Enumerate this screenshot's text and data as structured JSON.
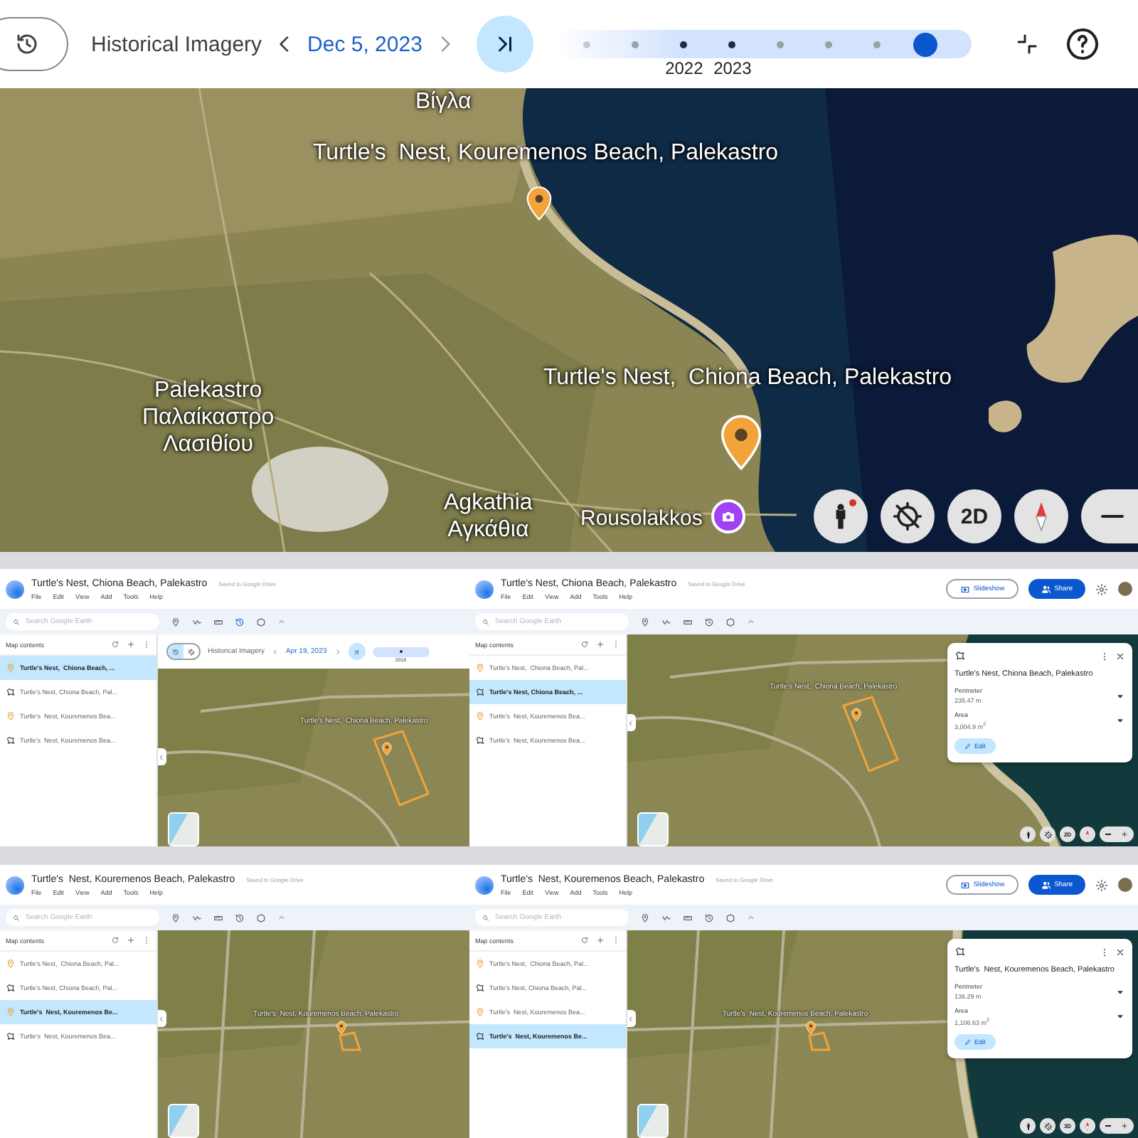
{
  "top_bar": {
    "history_label": "Historical Imagery",
    "date": "Dec 5, 2023",
    "timeline": [
      {
        "selected": false
      },
      {
        "selected": false
      },
      {
        "label": "2022",
        "selected": false
      },
      {
        "label": "2023",
        "selected": false
      },
      {
        "selected": false
      },
      {
        "selected": false
      },
      {
        "selected": false
      },
      {
        "selected": true
      }
    ]
  },
  "map": {
    "labels": [
      {
        "text": "Βίγλα"
      },
      {
        "text": "Turtle's  Nest, Kouremenos Beach, Palekastro"
      },
      {
        "text": "Turtle's Nest,  Chiona Beach, Palekastro"
      },
      {
        "text": "Palekastro\nΠαλαίκαστρο\nΛασιθίου"
      },
      {
        "text": "Agkathia\nΑγκάθια"
      },
      {
        "text": "Rousolakkos"
      }
    ],
    "mode_button": "2D"
  },
  "panels": [
    {
      "kind": "chiona",
      "title": "Turtle's Nest, Chiona Beach, Palekastro",
      "saved": "Saved to Google Drive",
      "menu": [
        "File",
        "Edit",
        "View",
        "Add",
        "Tools",
        "Help"
      ],
      "search": {
        "placeholder": "Search Google Earth"
      },
      "sidebar_title": "Map contents",
      "items": [
        {
          "kind": "pin",
          "label": "Turtle's Nest,  Chiona Beach, ...",
          "selected": true
        },
        {
          "kind": "polygon",
          "label": "Turtle's Nest, Chiona Beach, Pal...",
          "selected": false
        },
        {
          "kind": "pin",
          "label": "Turtle's  Nest, Kouremenos Bea...",
          "selected": false
        },
        {
          "kind": "polygon",
          "label": "Turtle's  Nest, Kouremenos Bea...",
          "selected": false
        }
      ],
      "history": {
        "label": "Historical Imagery",
        "date": "Apr 19, 2023",
        "year": "2018",
        "modes": [
          {
            "selected": true
          },
          {
            "selected": false
          }
        ]
      },
      "map_label": "Turtle's Nest,  Chiona Beach, Palekastro"
    },
    {
      "kind": "chiona",
      "title": "Turtle's Nest, Chiona Beach, Palekastro",
      "saved": "Saved to Google Drive",
      "menu": [
        "File",
        "Edit",
        "View",
        "Add",
        "Tools",
        "Help"
      ],
      "actions": [
        {
          "kind": "outline",
          "label": "Slideshow"
        },
        {
          "kind": "filled",
          "label": "Share"
        }
      ],
      "search": {
        "placeholder": "Search Google Earth"
      },
      "sidebar_title": "Map contents",
      "items": [
        {
          "kind": "pin",
          "label": "Turtle's Nest,  Chiona Beach, Pal...",
          "selected": false
        },
        {
          "kind": "polygon",
          "label": "Turtle's Nest, Chiona Beach, ...",
          "selected": true
        },
        {
          "kind": "pin",
          "label": "Turtle's  Nest, Kouremenos Bea...",
          "selected": false
        },
        {
          "kind": "polygon",
          "label": "Turtle's  Nest, Kouremenos Bea...",
          "selected": false
        }
      ],
      "map_label": "Turtle's Nest,  Chiona Beach, Palekastro",
      "card": {
        "title": "Turtle's Nest, Chiona Beach, Palekastro",
        "fields": [
          {
            "label": "Perimeter",
            "value": "235.47 m"
          },
          {
            "label": "Area",
            "value": "3,004.9 m$^{2}$"
          }
        ],
        "edit": "Edit"
      },
      "mode_button": "2D"
    },
    {
      "kind": "kouremenos",
      "title": "Turtle's  Nest, Kouremenos Beach, Palekastro",
      "saved": "Saved to Google Drive",
      "menu": [
        "File",
        "Edit",
        "View",
        "Add",
        "Tools",
        "Help"
      ],
      "search": {
        "placeholder": "Search Google Earth"
      },
      "sidebar_title": "Map contents",
      "items": [
        {
          "kind": "pin",
          "label": "Turtle's Nest,  Chiona Beach, Pal...",
          "selected": false
        },
        {
          "kind": "polygon",
          "label": "Turtle's Nest, Chiona Beach, Pal...",
          "selected": false
        },
        {
          "kind": "pin",
          "label": "Turtle's  Nest, Kouremenos Be...",
          "selected": true
        },
        {
          "kind": "polygon",
          "label": "Turtle's  Nest, Kouremenos Bea...",
          "selected": false
        }
      ],
      "map_label": "Turtle's  Nest, Kouremenos Beach, Palekastro"
    },
    {
      "kind": "kouremenos",
      "title": "Turtle's  Nest, Kouremenos Beach, Palekastro",
      "saved": "Saved to Google Drive",
      "menu": [
        "File",
        "Edit",
        "View",
        "Add",
        "Tools",
        "Help"
      ],
      "actions": [
        {
          "kind": "outline",
          "label": "Slideshow"
        },
        {
          "kind": "filled",
          "label": "Share"
        }
      ],
      "search": {
        "placeholder": "Search Google Earth"
      },
      "sidebar_title": "Map contents",
      "items": [
        {
          "kind": "pin",
          "label": "Turtle's Nest,  Chiona Beach, Pal...",
          "selected": false
        },
        {
          "kind": "polygon",
          "label": "Turtle's Nest, Chiona Beach, Pal...",
          "selected": false
        },
        {
          "kind": "pin",
          "label": "Turtle's  Nest, Kouremenos Bea...",
          "selected": false
        },
        {
          "kind": "polygon",
          "label": "Turtle's  Nest, Kouremenos Be...",
          "selected": true
        }
      ],
      "map_label": "Turtle's  Nest, Kouremenos Beach, Palekastro",
      "card": {
        "title": "Turtle's  Nest, Kouremenos Beach, Palekastro",
        "fields": [
          {
            "label": "Perimeter",
            "value": "136.29 m"
          },
          {
            "label": "Area",
            "value": "1,106.63 m$^{2}$"
          }
        ],
        "edit": "Edit"
      },
      "mode_button": "3D"
    }
  ]
}
